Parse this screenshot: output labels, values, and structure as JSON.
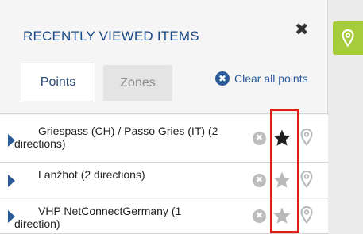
{
  "panel": {
    "title": "RECENTLY VIEWED ITEMS",
    "close_label": "✖"
  },
  "tabs": [
    {
      "label": "Points",
      "active": true
    },
    {
      "label": "Zones",
      "active": false
    }
  ],
  "clear_all": {
    "icon": "✖",
    "label": "Clear all points"
  },
  "items": [
    {
      "label": "Griespass (CH) / Passo Gries (IT) (2 directions)",
      "favorite": true,
      "remove_icon": "✖"
    },
    {
      "label": "Lanžhot (2 directions)",
      "favorite": false,
      "remove_icon": "✖"
    },
    {
      "label": "VHP NetConnectGermany (1 direction)",
      "favorite": false,
      "remove_icon": "✖"
    }
  ],
  "colors": {
    "accent": "#2a5a9a",
    "title": "#1a4a86",
    "map_tab": "#a7cc3b",
    "highlight": "#e31b1b",
    "star_active": "#1f1f1f",
    "star_inactive": "#b9b9b9"
  },
  "icons": {
    "row_arrow": "triangle-right-icon",
    "remove": "remove-circle-icon",
    "star": "star-icon",
    "pin": "map-pin-icon",
    "map_tab": "map-pin-icon"
  }
}
